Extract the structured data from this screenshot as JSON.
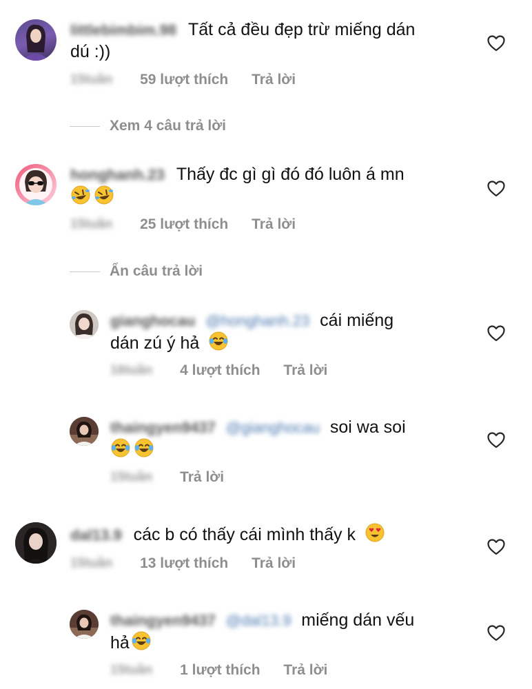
{
  "comments": [
    {
      "username": "littlebimbim.98",
      "text_line1": "Tất cả đều đẹp trừ miếng dán",
      "text_line2": "dú :))",
      "time": "15tuần",
      "likes": "59 lượt thích",
      "reply": "Trả lời"
    },
    {
      "username": "honghanh.23",
      "text_line1": "Thấy đc gì gì đó đó luôn á mn",
      "time": "15tuần",
      "likes": "25 lượt thích",
      "reply": "Trả lời"
    },
    {
      "username": "gianghocau",
      "mention": "@honghanh.23",
      "text_line1": "cái miếng",
      "text_line2": "dán zú ý hả",
      "time": "16tuần",
      "likes": "4 lượt thích",
      "reply": "Trả lời"
    },
    {
      "username": "thaingyen9437",
      "mention": "@gianghocau",
      "text_line1": "soi wa soi",
      "time": "15tuần",
      "reply": "Trả lời"
    },
    {
      "username": "dal13.9",
      "text_line1": "các b có thấy cái mình thấy k",
      "time": "15tuần",
      "likes": "13 lượt thích",
      "reply": "Trả lời"
    },
    {
      "username": "thaingyen9437",
      "mention": "@dal13.9",
      "text_line1": "miếng dán vếu",
      "text_line2": "hả",
      "time": "15tuần",
      "likes": "1 lượt thích",
      "reply": "Trả lời"
    }
  ],
  "threads": {
    "view_replies": "Xem 4 câu trả lời",
    "hide_replies": "Ẩn câu trả lời"
  },
  "icons": {
    "heart": "heart-outline-icon",
    "rofl": "rolling-on-floor-laughing-emoji",
    "tears_of_joy": "face-with-tears-of-joy-emoji",
    "heart_eyes": "heart-eyes-emoji"
  },
  "colors": {
    "meta_text": "#8e8e8e",
    "body_text": "#111111",
    "mention": "#4a78b0"
  }
}
